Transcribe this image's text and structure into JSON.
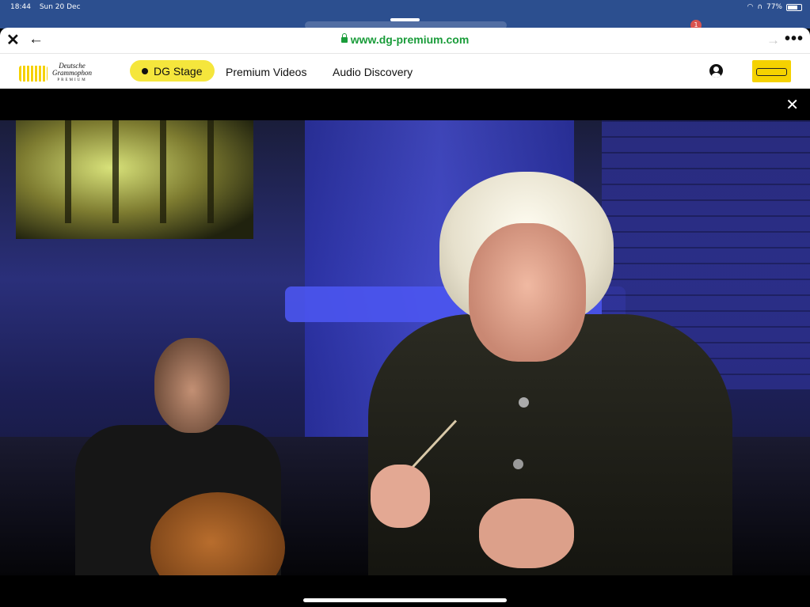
{
  "status_bar": {
    "time": "18:44",
    "date": "Sun 20 Dec",
    "battery": "77%",
    "battery_level": 0.77,
    "notification_count": "1",
    "icons": [
      "wifi-icon",
      "headphones-icon",
      "battery-icon"
    ]
  },
  "browser": {
    "close_icon": "close-icon",
    "back_icon": "back-arrow-icon",
    "url": "www.dg-premium.com",
    "forward_icon": "forward-arrow-icon",
    "more_icon": "more-icon"
  },
  "site_nav": {
    "logo_lines": [
      "Deutsche",
      "Grammophon",
      "PREMIUM"
    ],
    "stage_label": "DG Stage",
    "links": [
      "Premium Videos",
      "Audio Discovery"
    ],
    "account_icon": "user-icon",
    "brand_label_icon": "yellow-label-icon"
  },
  "player": {
    "close_icon": "close-icon"
  },
  "colors": {
    "status_bar_bg": "#2c4f8f",
    "url_green": "#1a9c3a",
    "stage_yellow": "#f5e63c",
    "brand_yellow": "#f5d200"
  }
}
